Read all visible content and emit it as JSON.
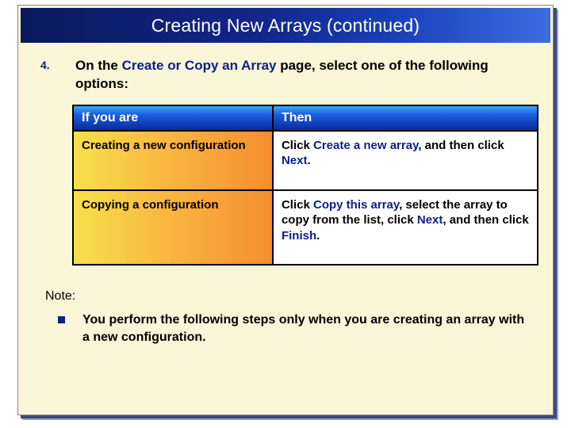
{
  "title": "Creating New Arrays (continued)",
  "step": {
    "number": "4.",
    "prefix": "On the ",
    "keyword": "Create or Copy an Array",
    "suffix": " page, select one of the following options:"
  },
  "table": {
    "headers": {
      "left": "If you are",
      "right": "Then"
    },
    "rows": [
      {
        "left": "Creating a new configuration",
        "right_parts": {
          "p1": "Click ",
          "k1": "Create a new array",
          "p2": ", and then click ",
          "k2": "Next",
          "p3": "."
        }
      },
      {
        "left": "Copying a configuration",
        "right_parts": {
          "p1": "Click ",
          "k1": "Copy this array",
          "p2": ", select the array to copy from the list, click ",
          "k2": "Next",
          "p3": ", and then click ",
          "k3": "Finish",
          "p4": "."
        }
      }
    ]
  },
  "note": {
    "label": "Note:",
    "text": "You perform the following steps only when you are creating an array with a new configuration."
  }
}
